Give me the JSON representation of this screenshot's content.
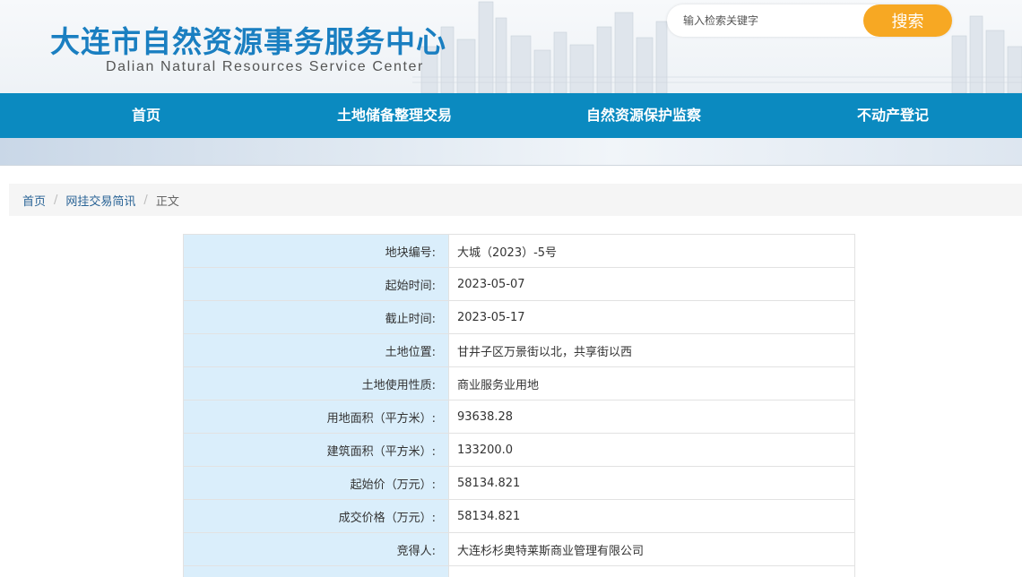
{
  "site": {
    "title": "大连市自然资源事务服务中心",
    "subtitle": "Dalian Natural Resources Service Center"
  },
  "search": {
    "placeholder": "输入检索关键字",
    "button": "搜索"
  },
  "nav": {
    "items": [
      {
        "label": "首页"
      },
      {
        "label": "土地储备整理交易"
      },
      {
        "label": "自然资源保护监察"
      },
      {
        "label": "不动产登记"
      }
    ]
  },
  "breadcrumb": {
    "home": "首页",
    "section": "网挂交易简讯",
    "current": "正文",
    "separator": "/"
  },
  "detail": {
    "rows": [
      {
        "label": "地块编号:",
        "value": "大城（2023）-5号"
      },
      {
        "label": "起始时间:",
        "value": "2023-05-07"
      },
      {
        "label": "截止时间:",
        "value": "2023-05-17"
      },
      {
        "label": "土地位置:",
        "value": "甘井子区万景街以北，共享街以西"
      },
      {
        "label": "土地使用性质:",
        "value": "商业服务业用地"
      },
      {
        "label": "用地面积（平方米）:",
        "value": "93638.28"
      },
      {
        "label": "建筑面积（平方米）:",
        "value": "133200.0"
      },
      {
        "label": "起始价（万元）:",
        "value": "58134.821"
      },
      {
        "label": "成交价格（万元）:",
        "value": "58134.821"
      },
      {
        "label": "竞得人:",
        "value": "大连杉杉奥特莱斯商业管理有限公司"
      },
      {
        "label": "",
        "value": ""
      }
    ]
  },
  "colors": {
    "brand_blue": "#0b8ac0",
    "title_blue": "#1a7fc1",
    "search_orange": "#f7a823",
    "label_bg": "#daeefb"
  }
}
